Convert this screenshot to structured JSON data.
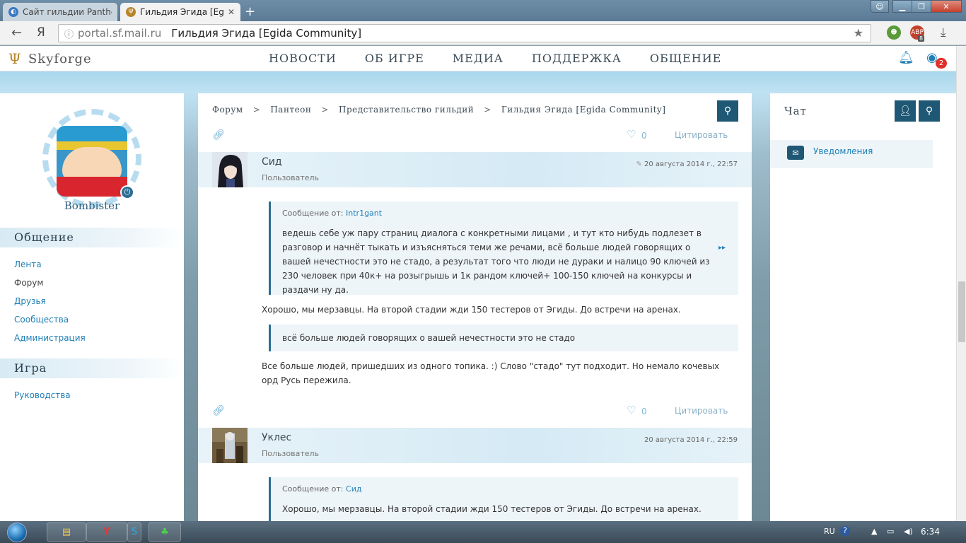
{
  "browser": {
    "tabs": [
      {
        "label": "Сайт гильдии Panthec",
        "active": false
      },
      {
        "label": "Гильдия Эгида [Egida",
        "active": true
      }
    ],
    "url_host": "portal.sf.mail.ru",
    "url_title": "Гильдия Эгида [Egida Community]",
    "yandex_letter": "Я",
    "ext_badge": "8"
  },
  "site": {
    "logo": "Skyforge",
    "nav": [
      "НОВОСТИ",
      "ОБ ИГРЕ",
      "МЕДИА",
      "ПОДДЕРЖКА",
      "ОБЩЕНИЕ"
    ],
    "notif_count": "2"
  },
  "sidebar": {
    "username": "Bombister",
    "sections": [
      {
        "title": "Общение",
        "items": [
          "Лента",
          "Форум",
          "Друзья",
          "Сообщества",
          "Администрация"
        ]
      },
      {
        "title": "Игра",
        "items": [
          "Руководства"
        ]
      }
    ]
  },
  "breadcrumb": [
    "Форум",
    "Пантеон",
    "Представительство гильдий",
    "Гильдия Эгида [Egida Community]"
  ],
  "post_actions": {
    "like_count": "0",
    "quote_label": "Цитировать"
  },
  "posts": [
    {
      "author": "Сид",
      "role": "Пользователь",
      "date": "20 августа 2014 г., 22:57",
      "quote1_from_label": "Сообщение от:",
      "quote1_author": "Intr1gant",
      "quote1_text": "ведешь себе уж пару страниц диалога с конкретными лицами , и тут кто нибудь подлезет в разговор и начнёт тыкать и изъясняться теми же речами, всё больше людей говорящих о вашей нечестности это не стадо, а результат того что люди не дураки и налицо 90 ключей из 230 человек при 40к+ на розыгрышь и 1к рандом ключей+  100-150 ключей на конкурсы и раздачи ну да.",
      "reply1": "Хорошо, мы мерзавцы. На второй стадии жди 150 тестеров от Эгиды. До встречи на аренах.",
      "quote2_text": "всё больше людей говорящих о вашей нечестности это не стадо",
      "reply2": "Все больше людей, пришедших из одного топика. :) Слово \"стадо\" тут подходит. Но немало кочевых орд Русь пережила."
    },
    {
      "author": "Уклес",
      "role": "Пользователь",
      "date": "20 августа 2014 г., 22:59",
      "quote1_from_label": "Сообщение от:",
      "quote1_author": "Сид",
      "quote1_text": "Хорошо, мы мерзавцы. На второй стадии жди 150 тестеров от Эгиды. До встречи на аренах."
    }
  ],
  "chat": {
    "title": "Чат",
    "notifications": "Уведомления"
  },
  "taskbar": {
    "lang": "RU",
    "clock": "6:34"
  },
  "colors": {
    "accent": "#1f5874",
    "link": "#1e7fb6",
    "badge": "#e0302a"
  }
}
